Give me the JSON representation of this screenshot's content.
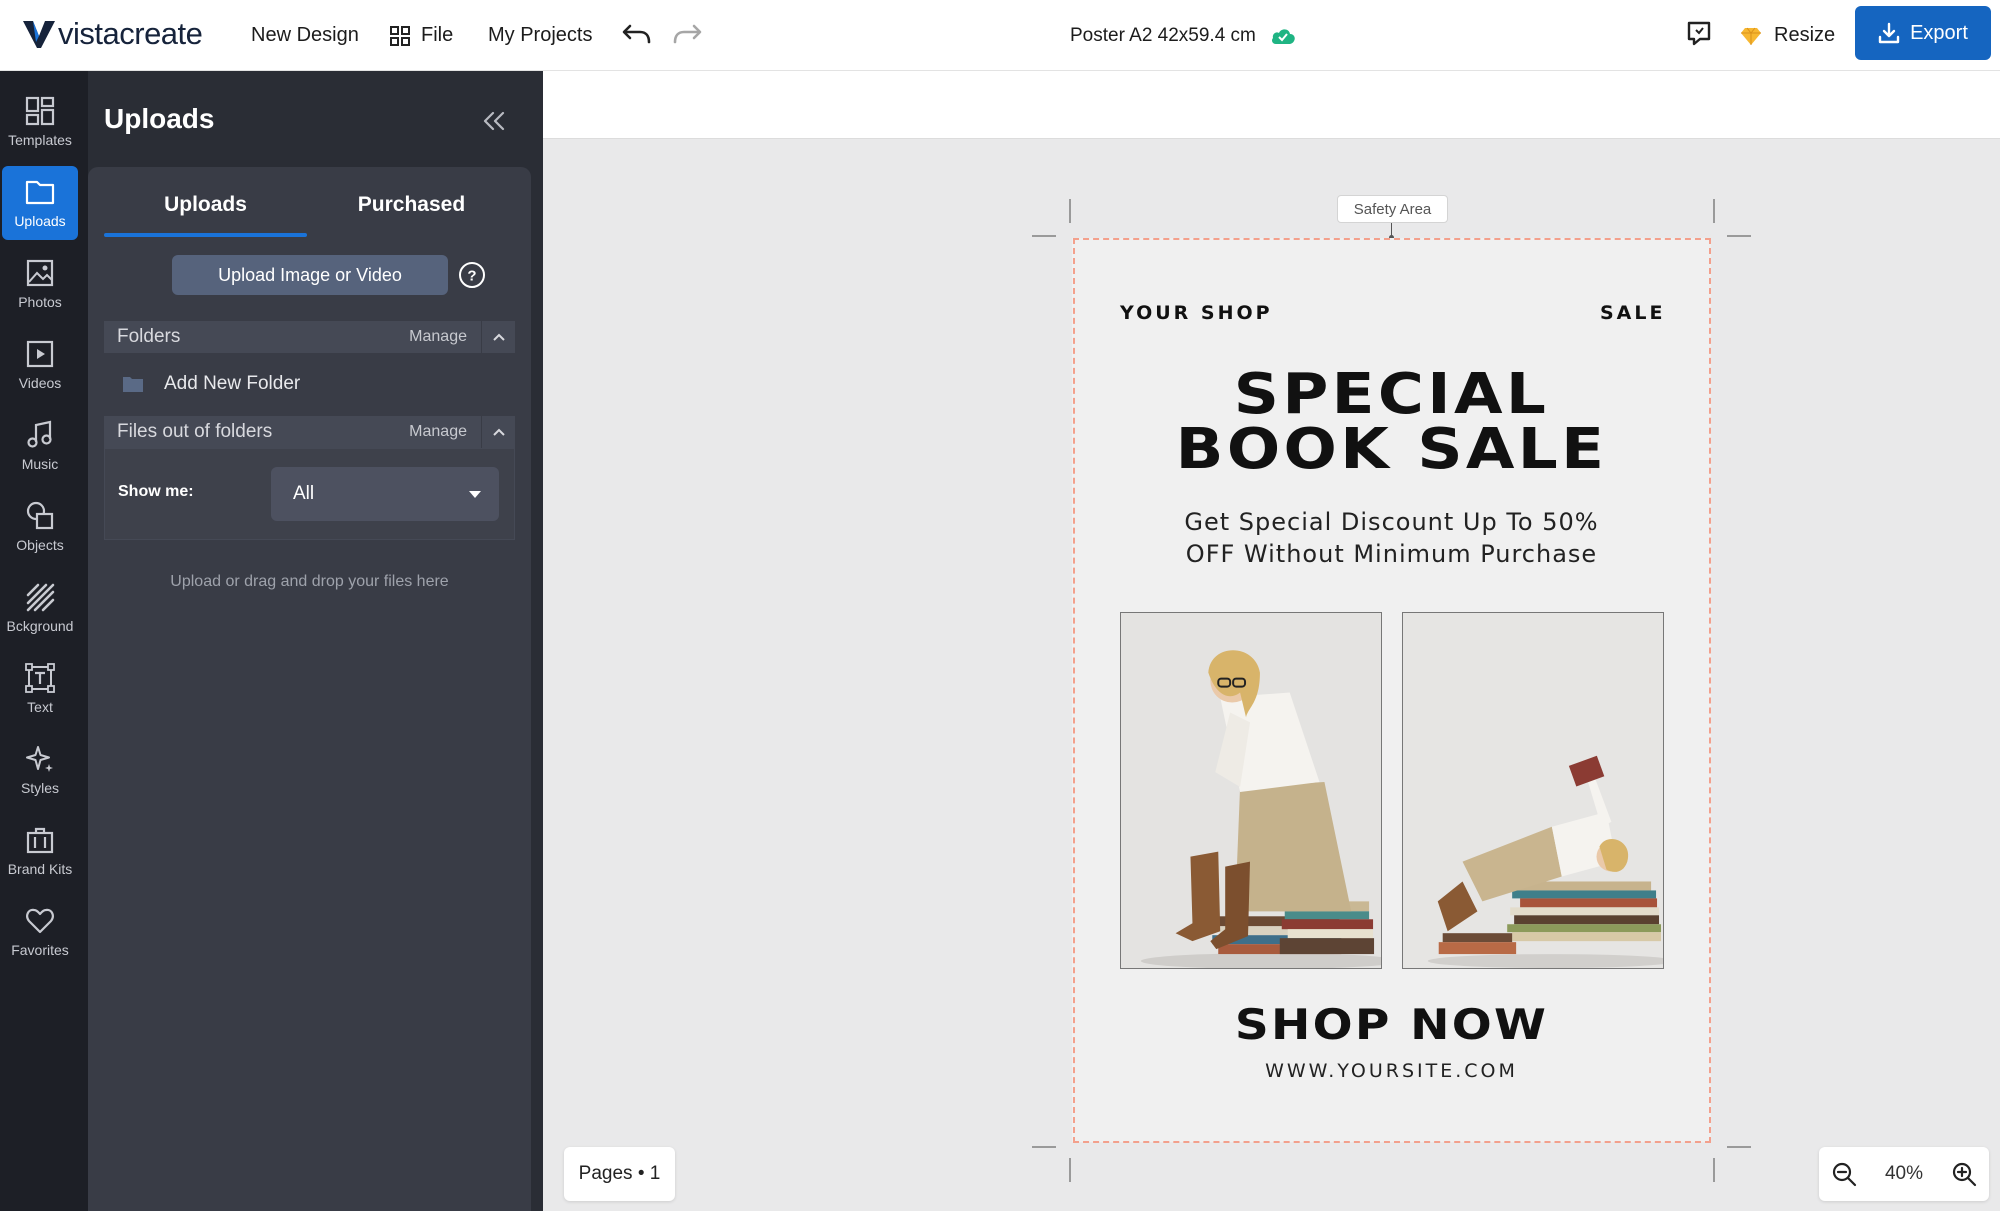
{
  "brand": {
    "logo_text": "vistacreate",
    "accent": "#1a73d9"
  },
  "topbar": {
    "new_design": "New Design",
    "file": "File",
    "my_projects": "My Projects",
    "doc_title": "Poster A2 42x59.4 cm",
    "resize": "Resize",
    "export": "Export"
  },
  "rail": {
    "items": [
      {
        "label": "Templates",
        "icon": "templates-icon"
      },
      {
        "label": "Uploads",
        "icon": "uploads-icon",
        "active": true
      },
      {
        "label": "Photos",
        "icon": "photos-icon"
      },
      {
        "label": "Videos",
        "icon": "videos-icon"
      },
      {
        "label": "Music",
        "icon": "music-icon"
      },
      {
        "label": "Objects",
        "icon": "objects-icon"
      },
      {
        "label": "Bckground",
        "icon": "background-icon"
      },
      {
        "label": "Text",
        "icon": "text-icon"
      },
      {
        "label": "Styles",
        "icon": "styles-icon"
      },
      {
        "label": "Brand Kits",
        "icon": "brand-kits-icon"
      },
      {
        "label": "Favorites",
        "icon": "favorites-icon"
      }
    ]
  },
  "panel": {
    "title": "Uploads",
    "tabs": [
      {
        "label": "Uploads",
        "active": true
      },
      {
        "label": "Purchased"
      }
    ],
    "upload_button": "Upload Image or Video",
    "folders": {
      "name": "Folders",
      "manage": "Manage"
    },
    "add_folder": "Add New Folder",
    "files": {
      "name": "Files out of folders",
      "manage": "Manage"
    },
    "filter": {
      "label": "Show me:",
      "selected": "All"
    },
    "drop_hint": "Upload or drag and drop your files here"
  },
  "canvas": {
    "safety_label": "Safety Area",
    "poster": {
      "shop": "YOUR SHOP",
      "sale": "SALE",
      "headline_1": "SPECIAL",
      "headline_2": "BOOK SALE",
      "sub_1": "Get Special Discount Up To 50%",
      "sub_2": "OFF Without Minimum Purchase",
      "cta": "SHOP NOW",
      "url": "WWW.YOURSITE.COM"
    }
  },
  "footer": {
    "pages": "Pages • 1",
    "zoom": "40%"
  }
}
